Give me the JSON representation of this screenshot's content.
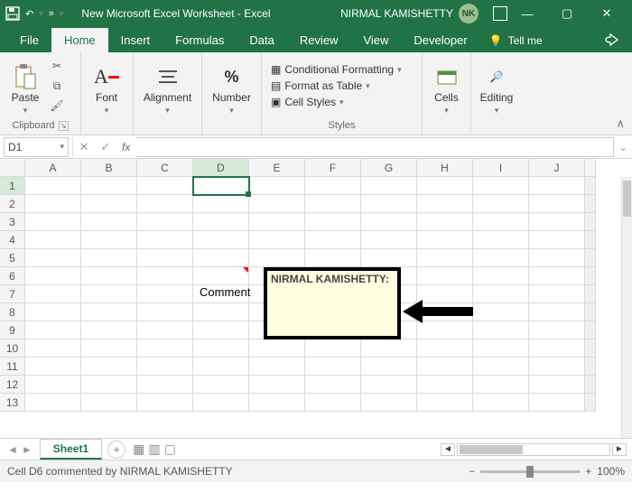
{
  "titlebar": {
    "doc_title": "New Microsoft Excel Worksheet - Excel",
    "user_name": "NIRMAL KAMISHETTY",
    "user_initials": "NK"
  },
  "tabs": {
    "file": "File",
    "home": "Home",
    "insert": "Insert",
    "formulas": "Formulas",
    "data": "Data",
    "review": "Review",
    "view": "View",
    "developer": "Developer",
    "tellme": "Tell me"
  },
  "ribbon": {
    "paste": "Paste",
    "clipboard": "Clipboard",
    "font": "Font",
    "alignment": "Alignment",
    "number": "Number",
    "cond_fmt": "Conditional Formatting",
    "fmt_table": "Format as Table",
    "cell_styles": "Cell Styles",
    "styles": "Styles",
    "cells": "Cells",
    "editing": "Editing"
  },
  "fxbar": {
    "namebox": "D1",
    "fx": "fx"
  },
  "grid": {
    "cols": [
      "A",
      "B",
      "C",
      "D",
      "E",
      "F",
      "G",
      "H",
      "I",
      "J"
    ],
    "rows": [
      "1",
      "2",
      "3",
      "4",
      "5",
      "6",
      "7",
      "8",
      "9",
      "10",
      "11",
      "12",
      "13"
    ],
    "comment_cell_text": "Comment",
    "comment_author": "NIRMAL KAMISHETTY:"
  },
  "sheet": {
    "name": "Sheet1"
  },
  "status": {
    "msg": "Cell D6 commented by NIRMAL KAMISHETTY",
    "zoom": "100%"
  }
}
